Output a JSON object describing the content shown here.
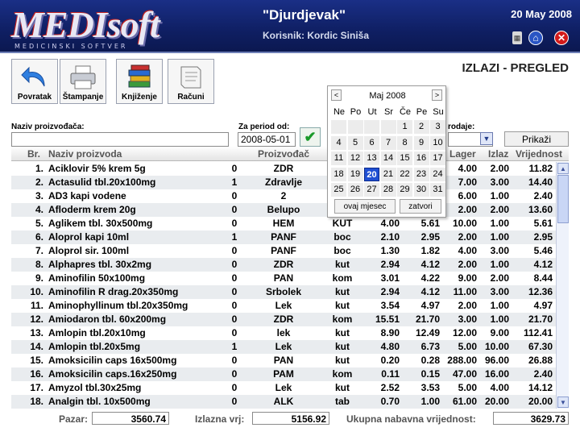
{
  "header": {
    "logo_text": "MEDIsoft",
    "logo_sub": "MEDICINSKI SOFTVER",
    "firm": "\"Djurdjevak\"",
    "user": "Korisnik: Kordic Siniša",
    "date": "20 May 2008"
  },
  "toolbar": {
    "back_label": "Povratak",
    "print_label": "Štampanje",
    "booking_label": "Knjiženje",
    "invoices_label": "Računi"
  },
  "page_title": "IZLAZI - PREGLED",
  "filters": {
    "manufacturer_label": "Naziv proizvođača:",
    "manufacturer_value": "",
    "period_label": "Za period od:",
    "period_value": "2008-05-01",
    "sale_label": "rodaje:",
    "show_button": "Prikaži"
  },
  "table": {
    "columns": [
      "Br.",
      "Naziv proizvoda",
      "Proizvođač",
      "Lager",
      "Izlaz",
      "Vrijednost"
    ],
    "rows": [
      {
        "no": "1.",
        "name": "Aciklovir 5% krem 5g",
        "flag": "0",
        "mfr": "ZDR",
        "unit": "",
        "p1": "",
        "p2": "",
        "lager": "4.00",
        "izlaz": "2.00",
        "value": "11.82"
      },
      {
        "no": "2.",
        "name": "Actasulid tbl.20x100mg",
        "flag": "1",
        "mfr": "Zdravlje",
        "unit": "",
        "p1": "",
        "p2": "",
        "lager": "7.00",
        "izlaz": "3.00",
        "value": "14.40"
      },
      {
        "no": "3.",
        "name": "AD3 kapi vodene",
        "flag": "0",
        "mfr": "2",
        "unit": "",
        "p1": "",
        "p2": "",
        "lager": "6.00",
        "izlaz": "1.00",
        "value": "2.40"
      },
      {
        "no": "4.",
        "name": "Afloderm krem 20g",
        "flag": "0",
        "mfr": "Belupo",
        "unit": "",
        "p1": "",
        "p2": "",
        "lager": "2.00",
        "izlaz": "2.00",
        "value": "13.60"
      },
      {
        "no": "5.",
        "name": "Aglikem tbl. 30x500mg",
        "flag": "0",
        "mfr": "HEM",
        "unit": "KUT",
        "p1": "4.00",
        "p2": "5.61",
        "lager": "10.00",
        "izlaz": "1.00",
        "value": "5.61"
      },
      {
        "no": "6.",
        "name": "Aloprol kapi 10ml",
        "flag": "1",
        "mfr": "PANF",
        "unit": "boc",
        "p1": "2.10",
        "p2": "2.95",
        "lager": "2.00",
        "izlaz": "1.00",
        "value": "2.95"
      },
      {
        "no": "7.",
        "name": "Aloprol sir. 100ml",
        "flag": "0",
        "mfr": "PANF",
        "unit": "boc",
        "p1": "1.30",
        "p2": "1.82",
        "lager": "4.00",
        "izlaz": "3.00",
        "value": "5.46"
      },
      {
        "no": "8.",
        "name": "Alphapres tbl. 30x2mg",
        "flag": "0",
        "mfr": "ZDR",
        "unit": "kut",
        "p1": "2.94",
        "p2": "4.12",
        "lager": "2.00",
        "izlaz": "1.00",
        "value": "4.12"
      },
      {
        "no": "9.",
        "name": "Aminofilin 50x100mg",
        "flag": "0",
        "mfr": "PAN",
        "unit": "kom",
        "p1": "3.01",
        "p2": "4.22",
        "lager": "9.00",
        "izlaz": "2.00",
        "value": "8.44"
      },
      {
        "no": "10.",
        "name": "Aminofilin R drag.20x350mg",
        "flag": "0",
        "mfr": "Srbolek",
        "unit": "kut",
        "p1": "2.94",
        "p2": "4.12",
        "lager": "11.00",
        "izlaz": "3.00",
        "value": "12.36"
      },
      {
        "no": "11.",
        "name": "Aminophyllinum tbl.20x350mg",
        "flag": "0",
        "mfr": "Lek",
        "unit": "kut",
        "p1": "3.54",
        "p2": "4.97",
        "lager": "2.00",
        "izlaz": "1.00",
        "value": "4.97"
      },
      {
        "no": "12.",
        "name": "Amiodaron tbl. 60x200mg",
        "flag": "0",
        "mfr": "ZDR",
        "unit": "kom",
        "p1": "15.51",
        "p2": "21.70",
        "lager": "3.00",
        "izlaz": "1.00",
        "value": "21.70"
      },
      {
        "no": "13.",
        "name": "Amlopin tbl.20x10mg",
        "flag": "0",
        "mfr": "lek",
        "unit": "kut",
        "p1": "8.90",
        "p2": "12.49",
        "lager": "12.00",
        "izlaz": "9.00",
        "value": "112.41"
      },
      {
        "no": "14.",
        "name": "Amlopin tbl.20x5mg",
        "flag": "1",
        "mfr": "Lek",
        "unit": "kut",
        "p1": "4.80",
        "p2": "6.73",
        "lager": "5.00",
        "izlaz": "10.00",
        "value": "67.30"
      },
      {
        "no": "15.",
        "name": "Amoksicilin caps 16x500mg",
        "flag": "0",
        "mfr": "PAN",
        "unit": "kut",
        "p1": "0.20",
        "p2": "0.28",
        "lager": "288.00",
        "izlaz": "96.00",
        "value": "26.88"
      },
      {
        "no": "16.",
        "name": "Amoksicilin caps.16x250mg",
        "flag": "0",
        "mfr": "PAM",
        "unit": "kom",
        "p1": "0.11",
        "p2": "0.15",
        "lager": "47.00",
        "izlaz": "16.00",
        "value": "2.40"
      },
      {
        "no": "17.",
        "name": "Amyzol tbl.30x25mg",
        "flag": "0",
        "mfr": "Lek",
        "unit": "kut",
        "p1": "2.52",
        "p2": "3.53",
        "lager": "5.00",
        "izlaz": "4.00",
        "value": "14.12"
      },
      {
        "no": "18.",
        "name": "Analgin tbl. 10x500mg",
        "flag": "0",
        "mfr": "ALK",
        "unit": "tab",
        "p1": "0.70",
        "p2": "1.00",
        "lager": "61.00",
        "izlaz": "20.00",
        "value": "20.00"
      }
    ]
  },
  "totals": {
    "pazar_label": "Pazar:",
    "pazar_value": "3560.74",
    "izlazna_label": "Izlazna vrj:",
    "izlazna_value": "5156.92",
    "nabavna_label": "Ukupna nabavna vrijednost:",
    "nabavna_value": "3629.73"
  },
  "calendar": {
    "title": "Maj 2008",
    "prev": "<",
    "next": ">",
    "weekdays": [
      "Ne",
      "Po",
      "Ut",
      "Sr",
      "Če",
      "Pe",
      "Su"
    ],
    "weeks": [
      [
        "",
        "",
        "",
        "",
        "1",
        "2",
        "3"
      ],
      [
        "4",
        "5",
        "6",
        "7",
        "8",
        "9",
        "10"
      ],
      [
        "11",
        "12",
        "13",
        "14",
        "15",
        "16",
        "17"
      ],
      [
        "18",
        "19",
        "20",
        "21",
        "22",
        "23",
        "24"
      ],
      [
        "25",
        "26",
        "27",
        "28",
        "29",
        "30",
        "31"
      ]
    ],
    "today": "20",
    "this_month_button": "ovaj mjesec",
    "close_button": "zatvori"
  }
}
